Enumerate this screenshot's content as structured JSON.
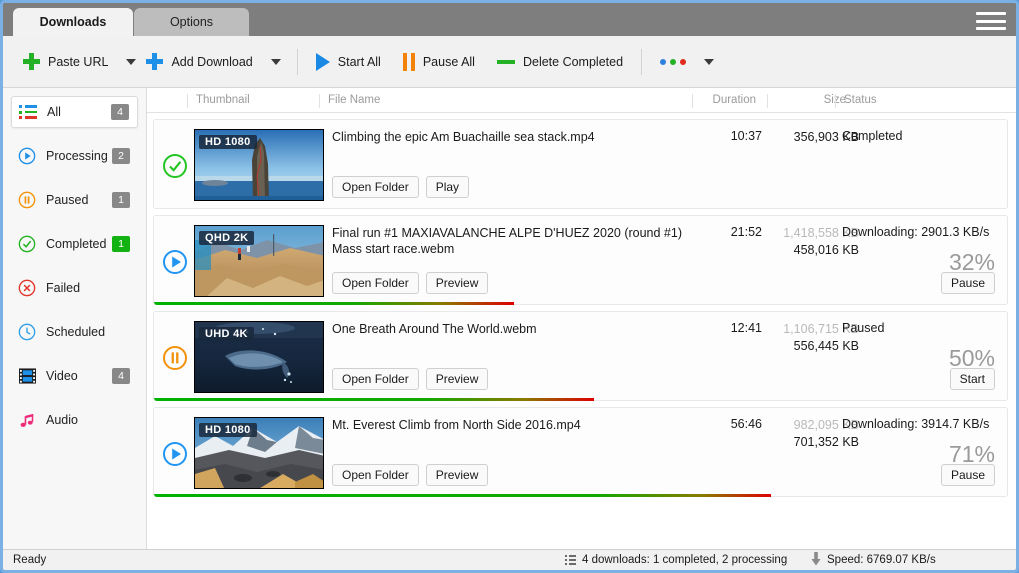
{
  "window": {
    "frame_color": "#7bb0e4",
    "titlebar_color": "#7e7e7e"
  },
  "tabs": [
    {
      "id": "downloads",
      "label": "Downloads",
      "active": true
    },
    {
      "id": "options",
      "label": "Options",
      "active": false
    }
  ],
  "menu_button": {
    "icon": "hamburger-menu-icon"
  },
  "toolbar": {
    "paste_url": {
      "label": "Paste URL",
      "icon": "plus-icon",
      "color": "#25b125"
    },
    "add_download": {
      "label": "Add Download",
      "icon": "plus-icon",
      "color": "#1e90e8"
    },
    "start_all": {
      "label": "Start All",
      "icon": "play-icon",
      "color": "#1989e4"
    },
    "pause_all": {
      "label": "Pause All",
      "icon": "pause-icon",
      "color": "#f2820a"
    },
    "delete_completed": {
      "label": "Delete Completed",
      "icon": "minus-icon",
      "color": "#25b125"
    },
    "more": {
      "icon": "three-dots-icon",
      "dot_colors": [
        "#2f7fe0",
        "#25b125",
        "#e02a1c"
      ]
    }
  },
  "sidebar": {
    "items": [
      {
        "id": "all",
        "label": "All",
        "icon": "list-icon",
        "badge": "4",
        "badge_style": "grey",
        "active": true
      },
      {
        "id": "processing",
        "label": "Processing",
        "icon": "play-circle-icon",
        "badge": "2",
        "badge_style": "grey",
        "active": false
      },
      {
        "id": "paused",
        "label": "Paused",
        "icon": "pause-circle-icon",
        "badge": "1",
        "badge_style": "grey",
        "active": false
      },
      {
        "id": "completed",
        "label": "Completed",
        "icon": "check-circle-icon",
        "badge": "1",
        "badge_style": "green",
        "active": false
      },
      {
        "id": "failed",
        "label": "Failed",
        "icon": "x-circle-icon",
        "badge": "",
        "badge_style": "none",
        "active": false
      },
      {
        "id": "scheduled",
        "label": "Scheduled",
        "icon": "clock-icon",
        "badge": "",
        "badge_style": "none",
        "active": false
      },
      {
        "id": "video",
        "label": "Video",
        "icon": "film-icon",
        "badge": "4",
        "badge_style": "grey",
        "active": false
      },
      {
        "id": "audio",
        "label": "Audio",
        "icon": "music-note-icon",
        "badge": "",
        "badge_style": "none",
        "active": false
      }
    ]
  },
  "table": {
    "headers": {
      "thumbnail": "Thumbnail",
      "file_name": "File Name",
      "duration": "Duration",
      "size": "Size",
      "status": "Status"
    },
    "rows": [
      {
        "state": "completed",
        "state_icon": "check-circle-icon",
        "quality_badge": "HD 1080",
        "file_name": "Climbing the epic Am Buachaille sea stack.mp4",
        "duration": "10:37",
        "size_total": "",
        "size_done": "356,903 KB",
        "status": "Completed",
        "percent": "",
        "progress": 100,
        "buttons": [
          "Open Folder",
          "Play"
        ],
        "action_button": ""
      },
      {
        "state": "downloading",
        "state_icon": "play-circle-icon",
        "quality_badge": "QHD 2K",
        "file_name": "Final run #1  MAXIAVALANCHE ALPE D'HUEZ 2020 (round #1) Mass start race.webm",
        "duration": "21:52",
        "size_total": "1,418,558 KB",
        "size_done": "458,016 KB",
        "status": "Downloading: 2901.3 KB/s",
        "percent": "32%",
        "progress": 32,
        "buttons": [
          "Open Folder",
          "Preview"
        ],
        "action_button": "Pause"
      },
      {
        "state": "paused",
        "state_icon": "pause-circle-icon",
        "quality_badge": "UHD 4K",
        "file_name": "One Breath Around The World.webm",
        "duration": "12:41",
        "size_total": "1,106,715 KB",
        "size_done": "556,445 KB",
        "status": "Paused",
        "percent": "50%",
        "progress": 50,
        "buttons": [
          "Open Folder",
          "Preview"
        ],
        "action_button": "Start"
      },
      {
        "state": "downloading",
        "state_icon": "play-circle-icon",
        "quality_badge": "HD 1080",
        "file_name": "Mt. Everest Climb from North Side 2016.mp4",
        "duration": "56:46",
        "size_total": "982,095 KB",
        "size_done": "701,352 KB",
        "status": "Downloading: 3914.7 KB/s",
        "percent": "71%",
        "progress": 71,
        "buttons": [
          "Open Folder",
          "Preview"
        ],
        "action_button": "Pause"
      }
    ]
  },
  "statusbar": {
    "ready": "Ready",
    "counts": "4 downloads: 1 completed, 2 processing",
    "counts_icon": "list-icon",
    "speed": "Speed: 6769.07 KB/s",
    "speed_icon": "download-arrow-icon"
  }
}
